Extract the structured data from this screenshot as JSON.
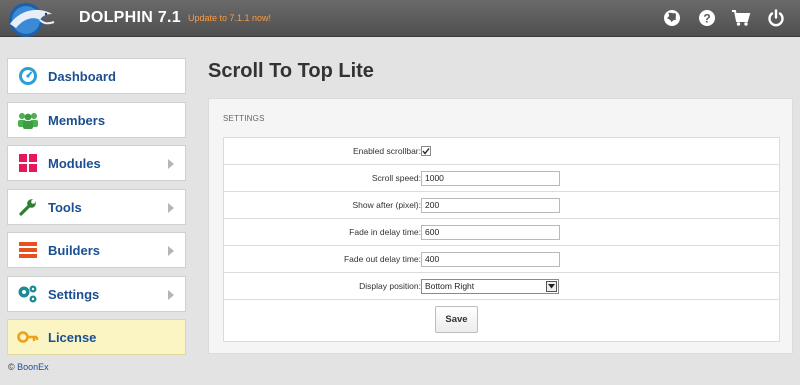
{
  "header": {
    "brand": "DOLPHIN 7.1",
    "update_link": "Update to 7.1.1 now!",
    "icons": [
      "globe-icon",
      "help-icon",
      "cart-icon",
      "power-icon"
    ]
  },
  "sidebar": {
    "items": [
      {
        "label": "Dashboard",
        "icon": "speedometer-icon",
        "color": "#2a9fd6",
        "has_submenu": false
      },
      {
        "label": "Members",
        "icon": "users-icon",
        "color": "#4caf50",
        "has_submenu": false
      },
      {
        "label": "Modules",
        "icon": "grid-icon",
        "color": "#e5195a",
        "has_submenu": true
      },
      {
        "label": "Tools",
        "icon": "wrench-icon",
        "color": "#2e7d32",
        "has_submenu": true
      },
      {
        "label": "Builders",
        "icon": "layers-icon",
        "color": "#e8501e",
        "has_submenu": true
      },
      {
        "label": "Settings",
        "icon": "gears-icon",
        "color": "#1a8c95",
        "has_submenu": true
      },
      {
        "label": "License",
        "icon": "key-icon",
        "color": "#f0a019",
        "has_submenu": false
      }
    ],
    "footer_prefix": "©",
    "footer_link": "BoonEx"
  },
  "main": {
    "title": "Scroll To Top Lite",
    "section_caption": "SETTINGS",
    "fields": {
      "enabled_scrollbar": {
        "label": "Enabled scrollbar:",
        "checked": true
      },
      "scroll_speed": {
        "label": "Scroll speed:",
        "value": "1000"
      },
      "show_after": {
        "label": "Show after (pixel):",
        "value": "200"
      },
      "fade_in": {
        "label": "Fade in delay time:",
        "value": "600"
      },
      "fade_out": {
        "label": "Fade out delay time:",
        "value": "400"
      },
      "display_position": {
        "label": "Display position:",
        "value": "Bottom Right"
      }
    },
    "save_label": "Save"
  },
  "colors": {
    "topbar": "#5a5a5a",
    "link_blue": "#1c4f91",
    "update_orange": "#ff9a3c",
    "license_bg": "#fbf5c4"
  }
}
